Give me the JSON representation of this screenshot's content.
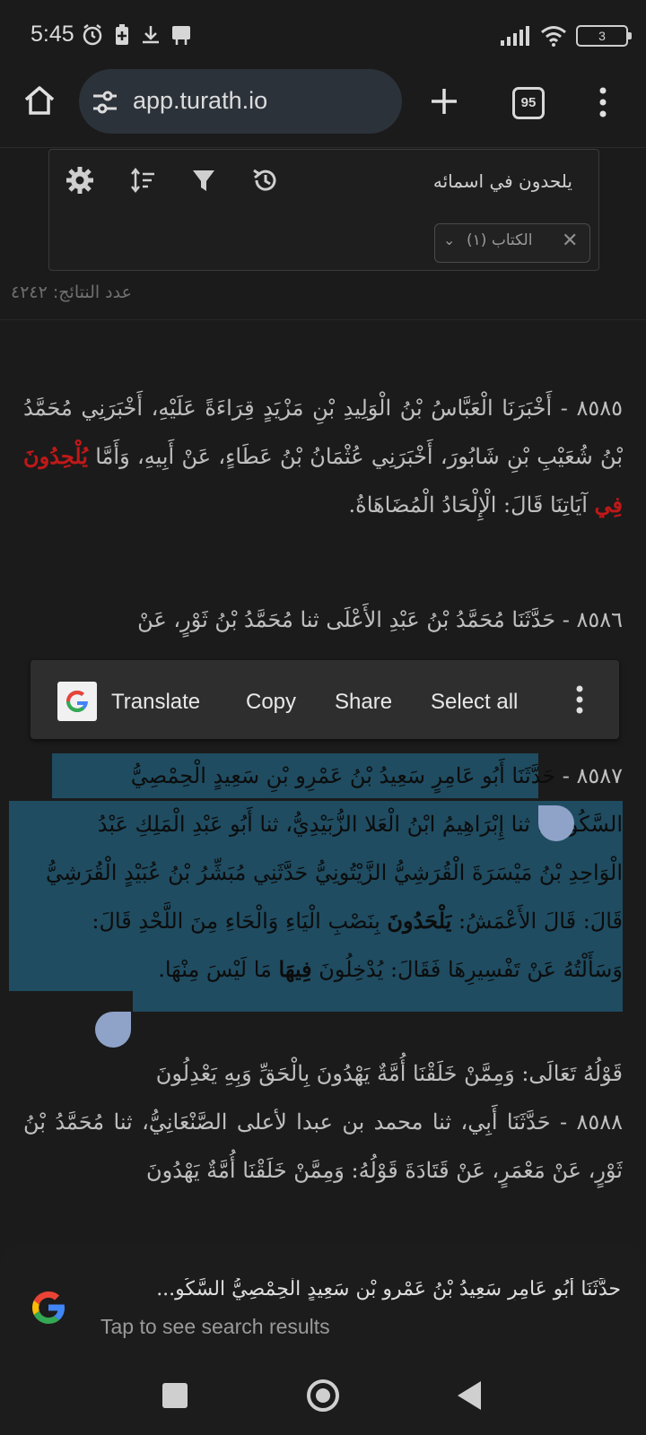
{
  "status_bar": {
    "time": "5:45",
    "left_icons": [
      "alarm-icon",
      "battery-saver-icon",
      "download-icon",
      "notification-icon"
    ],
    "right_icons": [
      "signal-icon",
      "wifi-icon",
      "battery-icon"
    ],
    "battery_level": "3"
  },
  "browser": {
    "url": "app.turath.io",
    "tab_count": "95",
    "icons": [
      "home-icon",
      "site-settings-icon",
      "new-tab-icon",
      "tabs-icon",
      "menu-icon"
    ]
  },
  "search": {
    "query": "يلحدون في اسمائه",
    "tool_icons": [
      "settings-icon",
      "sort-icon",
      "filter-icon",
      "history-icon"
    ],
    "filter_chip": "الكتاب (١)",
    "result_count": "عدد النتائج: ٤٢٤٢"
  },
  "content": {
    "p8585": {
      "before": "٨٥٨٥ - أَخْبَرَنَا الْعَبَّاسُ بْنُ الْوَلِيدِ بْنِ مَزْيَدٍ قِرَاءَةً عَلَيْهِ، أَخْبَرَنِي مُحَمَّدُ بْنُ شُعَيْبِ بْنِ شَابُورَ، أَخْبَرَنِي عُثْمَانُ بْنُ عَطَاءٍ، عَنْ أَبِيهِ، وَأَمَّا ",
      "highlight": "يُلْحِدُونَ فِي",
      "after": " آيَاتِنَا قَالَ: الْإِلْحَادُ الْمُضَاهَاةُ."
    },
    "p8586": "٨٥٨٦ - حَدَّثَنَا مُحَمَّدُ بْنُ عَبْدِ الأَعْلَى ثنا مُحَمَّدُ بْنُ ثَوْرٍ، عَنْ",
    "p8587": {
      "number": "٨٥٨٧ - ",
      "line1": "حَدَّثَنَا أَبُو عَامِرٍ سَعِيدُ بْنُ عَمْرِو بْنِ سَعِيدٍ الْحِمْصِيُّ",
      "line2": "السَّكُونِيُّ، ثنا إِبْرَاهِيمُ ابْنُ الْعَلا الزُّبَيْدِيُّ، ثنا أَبُو عَبْدِ الْمَلِكِ عَبْدُ",
      "line3": "الْوَاحِدِ بْنُ مَيْسَرَةَ الْقُرَشِيُّ الزَّيْتُونِيُّ حَدَّثَنِي مُبَشِّرُ بْنُ عُبَيْدٍ الْقُرَشِيُّ",
      "line4_before": "قَالَ: قَالَ الأَعْمَشُ: ",
      "line4_bold": "يَلْحَدُونَ",
      "line4_after": " بِنَصْبِ الْيَاءِ وَالْحَاءِ مِنَ اللَّحْدِ قَالَ:",
      "line5_before": "وَسَأَلْتُهُ عَنْ تَفْسِيرِهَا فَقَالَ: يُدْخِلُونَ ",
      "line5_bold": "فِيهَا",
      "line5_after": " مَا لَيْسَ مِنْهَا."
    },
    "verse": "قَوْلُهُ تَعَالَى: وَمِمَّنْ خَلَقْنَا أُمَّةٌ يَهْدُونَ بِالْحَقِّ وَبِهِ يَعْدِلُونَ",
    "p8588": "٨٥٨٨ - حَدَّثَنَا أَبِي، ثنا محمد بن عبدا لأعلى الصَّنْعَانِيُّ، ثنا مُحَمَّدُ بْنُ ثَوْرٍ، عَنْ مَعْمَرٍ، عَنْ قَتَادَةَ قَوْلُهُ: وَمِمَّنْ خَلَقْنَا أُمَّةٌ يَهْدُونَ"
  },
  "context_menu": {
    "items": [
      "Translate",
      "Copy",
      "Share",
      "Select all"
    ]
  },
  "bottom_sheet": {
    "title": "حدَّثَنَا أَبُو عَامِرٍ سَعِيدُ بْنُ عَمْرِو بْنِ سَعِيدٍ الْحِمْصِيُّ السَّكُو...",
    "subtitle": "Tap to see search results"
  },
  "nav_bar": {
    "icons": [
      "recents-icon",
      "home-circle-icon",
      "back-icon"
    ]
  },
  "colors": {
    "background": "#1b1b1b",
    "selection": "#1f4c61",
    "highlight_red": "#c01818",
    "url_pill": "#2c323a"
  }
}
